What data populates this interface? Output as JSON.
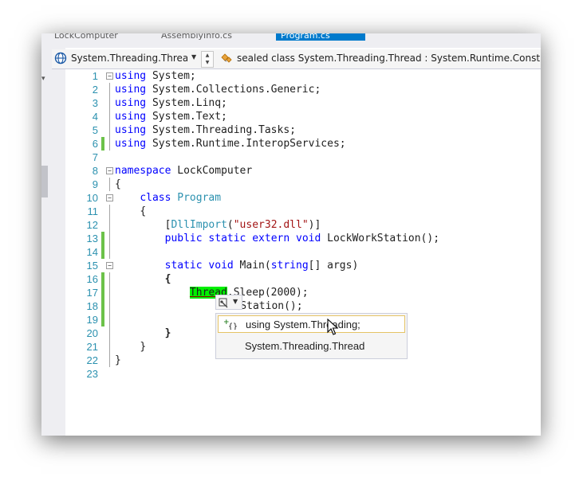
{
  "tabs": [
    "LockComputer",
    "AssemblyInfo.cs",
    "Program.cs"
  ],
  "navbar": {
    "left_scope": "System.Threading.Threac",
    "right_scope": "sealed class System.Threading.Thread : System.Runtime.Constrain"
  },
  "code_lines": [
    {
      "num": "1"
    },
    {
      "num": "2"
    },
    {
      "num": "3"
    },
    {
      "num": "4"
    },
    {
      "num": "5"
    },
    {
      "num": "6"
    },
    {
      "num": "7"
    },
    {
      "num": "8"
    },
    {
      "num": "9"
    },
    {
      "num": "10"
    },
    {
      "num": "11"
    },
    {
      "num": "12"
    },
    {
      "num": "13"
    },
    {
      "num": "14"
    },
    {
      "num": "15"
    },
    {
      "num": "16"
    },
    {
      "num": "17"
    },
    {
      "num": "18"
    },
    {
      "num": "19"
    },
    {
      "num": "20"
    },
    {
      "num": "21"
    },
    {
      "num": "22"
    },
    {
      "num": "23"
    }
  ],
  "code": {
    "kw_using": "using",
    "ns_system": "System;",
    "ns_collections": "System.Collections.Generic;",
    "ns_linq": "System.Linq;",
    "ns_text": "System.Text;",
    "ns_tasks": "System.Threading.Tasks;",
    "ns_interop": "System.Runtime.InteropServices;",
    "kw_namespace": "namespace",
    "namespace_name": " LockComputer",
    "brace_open": "{",
    "brace_close": "}",
    "kw_class": "class",
    "class_name": "Program",
    "attr_open": "[",
    "attr_name": "DllImport",
    "paren_open": "(",
    "attr_arg": "\"user32.dll\"",
    "attr_close": ")]",
    "kw_public": "public",
    "kw_static": "static",
    "kw_extern": "extern",
    "kw_void": "void",
    "extern_sig": " LockWorkStation();",
    "main_name": " Main(",
    "kw_string": "string",
    "main_args": "[] args)",
    "thread_type": "Thread",
    "sleep_call": ".Sleep(2000);",
    "lock_call": "WorkStation();"
  },
  "quick_actions": {
    "option_using": "using System.Threading;",
    "option_qualify": "System.Threading.Thread"
  },
  "colors": {
    "keyword": "#0000ff",
    "type": "#2b91af",
    "string": "#a31515",
    "change_bar": "#6cc24a",
    "error_highlight": "#00f000",
    "active_tab": "#007acc"
  }
}
